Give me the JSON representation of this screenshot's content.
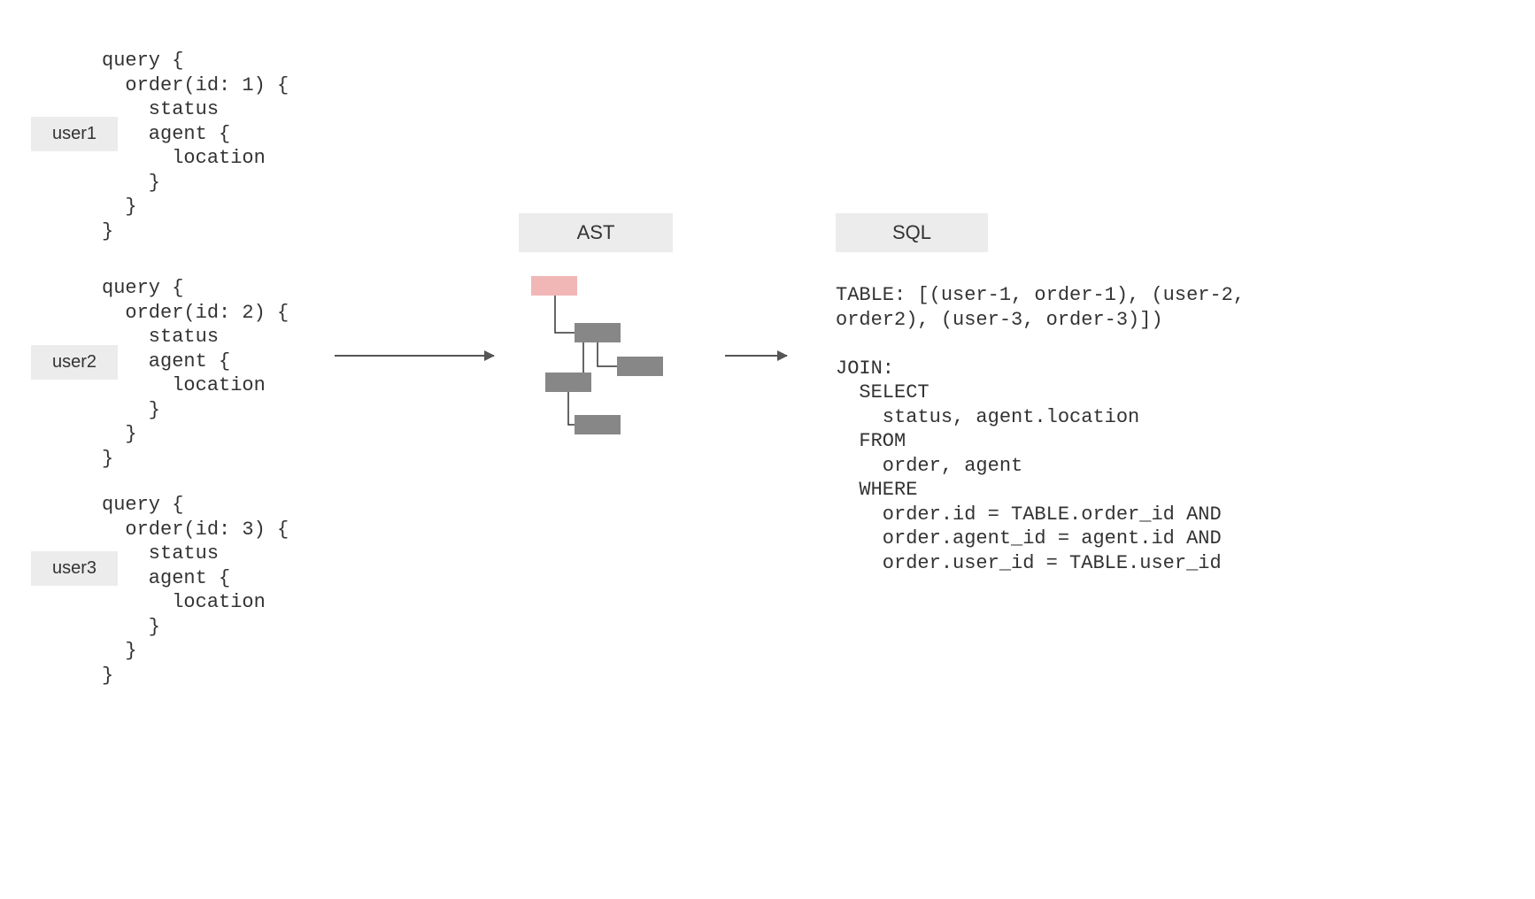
{
  "users": {
    "u1": "user1",
    "u2": "user2",
    "u3": "user3"
  },
  "queries": {
    "q1": "query {\n  order(id: 1) {\n    status\n    agent {\n      location\n    }\n  }\n}",
    "q2": "query {\n  order(id: 2) {\n    status\n    agent {\n      location\n    }\n  }\n}",
    "q3": "query {\n  order(id: 3) {\n    status\n    agent {\n      location\n    }\n  }\n}"
  },
  "headers": {
    "ast": "AST",
    "sql": "SQL"
  },
  "sql": "TABLE: [(user-1, order-1), (user-2,\norder2), (user-3, order-3)])\n\nJOIN:\n  SELECT\n    status, agent.location\n  FROM\n    order, agent\n  WHERE\n    order.id = TABLE.order_id AND\n    order.agent_id = agent.id AND\n    order.user_id = TABLE.user_id"
}
